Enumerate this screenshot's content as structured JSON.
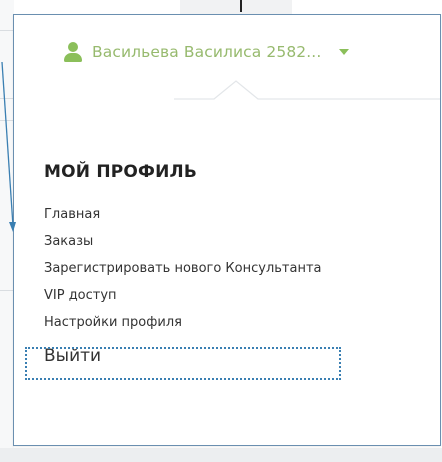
{
  "user_menu": {
    "user_name": "Васильева Василиса 2582...",
    "accent_color": "#8bbf5a",
    "icons": {
      "user": "user-icon",
      "toggle": "caret-down-icon"
    }
  },
  "profile_menu": {
    "title": "МОЙ ПРОФИЛЬ",
    "items": [
      {
        "label": "Главная"
      },
      {
        "label": "Заказы"
      },
      {
        "label": "Зарегистрировать нового Консультанта"
      },
      {
        "label": "VIP доступ"
      },
      {
        "label": "Настройки профиля"
      }
    ],
    "logout_label": "Выйти"
  },
  "annotation": {
    "highlight_color": "#3a7fb2"
  }
}
